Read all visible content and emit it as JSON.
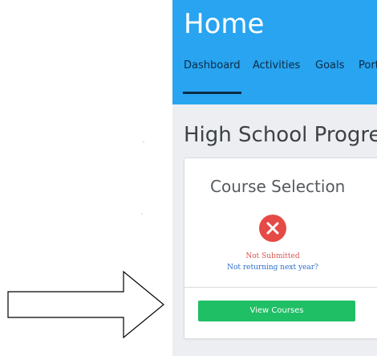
{
  "header": {
    "title": "Home",
    "tabs": [
      {
        "label": "Dashboard",
        "active": true
      },
      {
        "label": "Activities",
        "active": false
      },
      {
        "label": "Goals",
        "active": false
      },
      {
        "label": "Port",
        "active": false
      }
    ]
  },
  "main": {
    "section_title": "High School Progress",
    "card": {
      "title": "Course Selection",
      "status_icon": "x-icon",
      "status": "Not Submitted",
      "link": "Not returning next year?",
      "button_label": "View Courses"
    }
  },
  "colors": {
    "header_bg": "#28a4f0",
    "header_text": "#ffffff",
    "tab_text": "#0b2c45",
    "status_red": "#e54a46",
    "link_blue": "#2a6dcb",
    "button_green": "#1fbf65"
  }
}
